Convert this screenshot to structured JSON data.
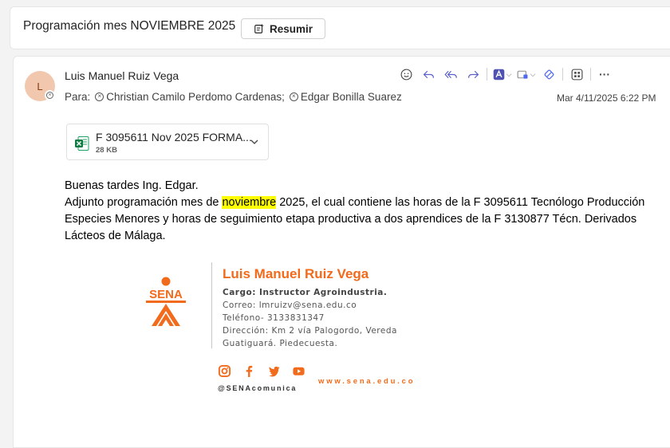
{
  "subject": {
    "title": "Programación mes NOVIEMBRE 2025",
    "summarize_label": "Resumir"
  },
  "message": {
    "avatar_initial": "L",
    "sender": "Luis Manuel Ruiz Vega",
    "to_label": "Para:",
    "recipients": [
      "Christian Camilo Perdomo Cardenas;",
      "Edgar Bonilla Suarez"
    ],
    "date": "Mar 4/11/2025 6:22 PM",
    "toolbar_icons": [
      "emoji-icon",
      "reply-icon",
      "reply-all-icon",
      "forward-icon",
      "apps-icon",
      "label-icon",
      "loop-icon",
      "grid-icon",
      "more-icon"
    ],
    "more_label": "···"
  },
  "attachment": {
    "name": "F 3095611 Nov 2025 FORMA...",
    "size": "28 KB",
    "icon": "excel-icon"
  },
  "body": {
    "greeting": "Buenas tardes Ing. Edgar.",
    "line_part1": "Adjunto programación mes de ",
    "highlight": "noviembre",
    "line_part2": " 2025, el cual contiene las horas de la F 3095611 Tecnólogo Producción Especies Menores y  horas de seguimiento etapa productiva a  dos aprendices de la F 3130877 Técn. Derivados Lácteos de Málaga."
  },
  "signature": {
    "logo_text": "SENA",
    "name": "Luis Manuel Ruiz Vega",
    "role": "Cargo: Instructor Agroindustria.",
    "email": "Correo: lmruizv@sena.edu.co",
    "phone": "Teléfono- 3133831347",
    "address1": "Dirección: Km 2 vía Palogordo, Vereda",
    "address2": "Guatiguará. Piedecuesta.",
    "social_icons": [
      "instagram-icon",
      "facebook-icon",
      "twitter-icon",
      "youtube-icon"
    ],
    "handle": "@SENAcomunica",
    "website": "www.sena.edu.co",
    "accent_color": "#f26a1b"
  }
}
